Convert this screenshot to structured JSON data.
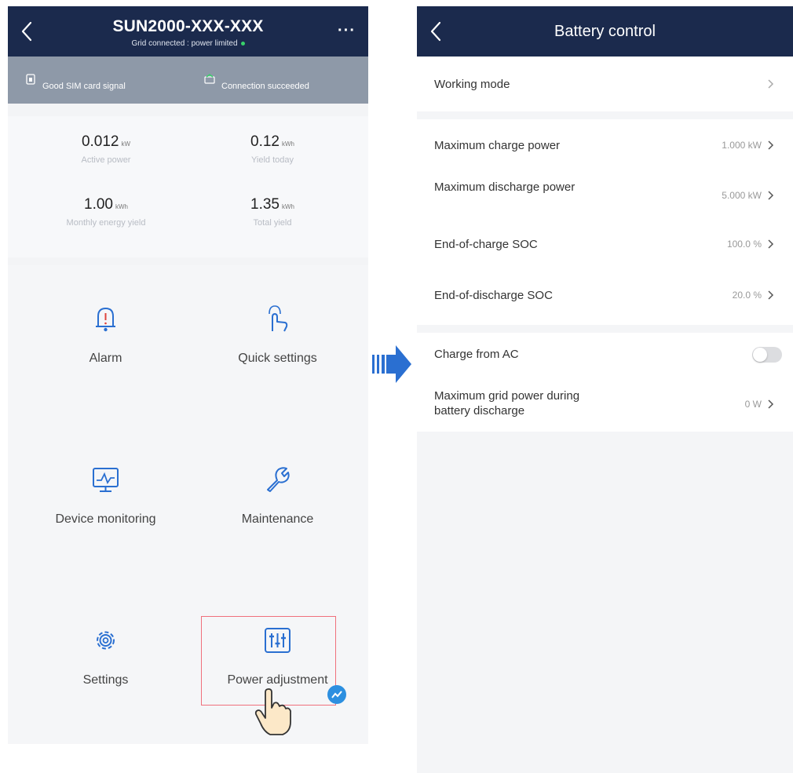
{
  "left_screen": {
    "header": {
      "title": "SUN2000-XXX-XXX",
      "subtitle": "Grid connected : power limited",
      "more_label": "···"
    },
    "status": {
      "sim_label": "Good SIM card signal",
      "connection_label": "Connection succeeded"
    },
    "stats": [
      {
        "value": "0.012",
        "unit": "kW",
        "label": "Active power"
      },
      {
        "value": "0.12",
        "unit": "kWh",
        "label": "Yield today"
      },
      {
        "value": "1.00",
        "unit": "kWh",
        "label": "Monthly energy yield"
      },
      {
        "value": "1.35",
        "unit": "kWh",
        "label": "Total yield"
      }
    ],
    "tiles": [
      {
        "label": "Alarm",
        "icon": "alarm-bell-icon"
      },
      {
        "label": "Quick settings",
        "icon": "quick-settings-icon"
      },
      {
        "label": "Device monitoring",
        "icon": "device-monitoring-icon"
      },
      {
        "label": "Maintenance",
        "icon": "maintenance-icon"
      },
      {
        "label": "Settings",
        "icon": "gear-icon"
      },
      {
        "label": "Power adjustment",
        "icon": "power-adjustment-icon"
      }
    ]
  },
  "right_screen": {
    "header": {
      "title": "Battery control"
    },
    "rows": [
      {
        "label": "Working mode",
        "value": ""
      },
      {
        "label": "Maximum charge power",
        "value": "1.000 kW"
      },
      {
        "label": "Maximum discharge power",
        "value": "5.000 kW"
      },
      {
        "label": "End-of-charge SOC",
        "value": "100.0 %"
      },
      {
        "label": "End-of-discharge SOC",
        "value": "20.0 %"
      },
      {
        "label": "Charge from AC",
        "value": "",
        "toggle_on": false
      },
      {
        "label": "Maximum grid power during battery discharge",
        "value": "0 W"
      }
    ]
  },
  "colors": {
    "header_bg": "#1b2a4d",
    "status_bg": "#8e99a8",
    "accent_blue": "#2a6fd1",
    "highlight_red": "#f0707c",
    "connected_green": "#38d16a"
  }
}
